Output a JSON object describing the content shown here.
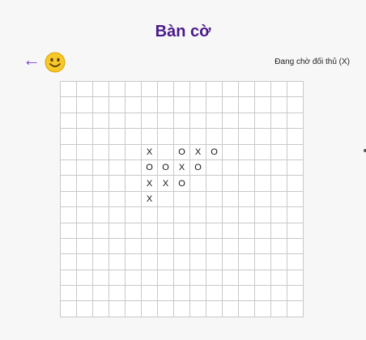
{
  "header": {
    "title": "Bàn cờ",
    "back_label": "←",
    "status": "Đang chờ đối thủ (X)"
  },
  "colors": {
    "title": "#4a1a8a",
    "back_arrow": "#7b3fd0",
    "smiley": "#f6c82a"
  },
  "icons": {
    "back": "back-arrow-icon",
    "avatar": "smiley-face-icon"
  },
  "board": {
    "rows": 15,
    "cols": 15,
    "moves": [
      {
        "row": 4,
        "col": 5,
        "mark": "X"
      },
      {
        "row": 4,
        "col": 7,
        "mark": "O"
      },
      {
        "row": 4,
        "col": 8,
        "mark": "X"
      },
      {
        "row": 4,
        "col": 9,
        "mark": "O"
      },
      {
        "row": 5,
        "col": 5,
        "mark": "O"
      },
      {
        "row": 5,
        "col": 6,
        "mark": "O"
      },
      {
        "row": 5,
        "col": 7,
        "mark": "X"
      },
      {
        "row": 5,
        "col": 8,
        "mark": "O"
      },
      {
        "row": 6,
        "col": 5,
        "mark": "X"
      },
      {
        "row": 6,
        "col": 6,
        "mark": "X"
      },
      {
        "row": 6,
        "col": 7,
        "mark": "O"
      },
      {
        "row": 7,
        "col": 5,
        "mark": "X"
      }
    ]
  }
}
